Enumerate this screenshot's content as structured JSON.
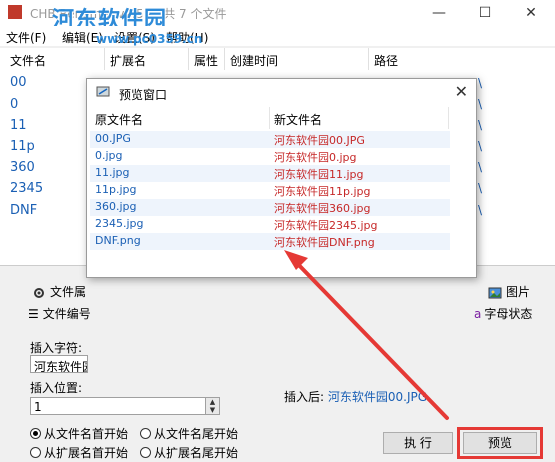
{
  "window": {
    "title": "CHB Renamer v2.5 — 共 7 个文件",
    "watermark": "河东软件园",
    "watermark_url": "www.pc0359.cn",
    "controls": [
      "—",
      "☐",
      "✕"
    ]
  },
  "menu": [
    "文件(F)",
    "编辑(E)",
    "设置(S)",
    "帮助(H)"
  ],
  "filelist": {
    "columns": [
      "文件名",
      "扩展名",
      "属性",
      "创建时间",
      "路径"
    ],
    "rows": [
      "00",
      "0",
      "11",
      "11p",
      "360",
      "2345",
      "DNF"
    ],
    "path_tail": "\\"
  },
  "tabs": {
    "row1_left": "文件属",
    "row1_right": "图片",
    "row2_left": "文件编号",
    "row2_right": "字母状态",
    "row2_right_prefix": "a"
  },
  "lower": {
    "insert_char_label": "插入字符:",
    "insert_char_value": "河东软件园",
    "insert_pos_label": "插入位置:",
    "insert_pos_value": "1",
    "radio_from_name_start": "从文件名首开始",
    "radio_from_name_end": "从文件名尾开始",
    "radio_from_ext_start": "从扩展名首开始",
    "radio_from_ext_end": "从扩展名尾开始",
    "insert_after_label": "插入后:",
    "insert_after_value": "河东软件园00.JPG",
    "execute_label": "执 行",
    "preview_label": "预览"
  },
  "dialog": {
    "title": "预览窗口",
    "col_old": "原文件名",
    "col_new": "新文件名",
    "rows": [
      {
        "old": "00.JPG",
        "new": "河东软件园00.JPG"
      },
      {
        "old": "0.jpg",
        "new": "河东软件园0.jpg"
      },
      {
        "old": "11.jpg",
        "new": "河东软件园11.jpg"
      },
      {
        "old": "11p.jpg",
        "new": "河东软件园11p.jpg"
      },
      {
        "old": "360.jpg",
        "new": "河东软件园360.jpg"
      },
      {
        "old": "2345.jpg",
        "new": "河东软件园2345.jpg"
      },
      {
        "old": "DNF.png",
        "new": "河东软件园DNF.png"
      }
    ]
  },
  "colors": {
    "accent_blue": "#1a5fb4",
    "new_name_red": "#c62828",
    "highlight_red": "#e53935"
  }
}
